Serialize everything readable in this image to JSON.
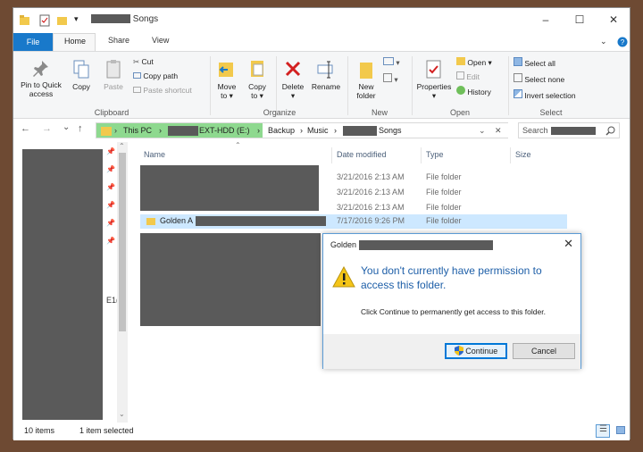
{
  "window": {
    "title_suffix": "Songs",
    "controls": {
      "minimize": "–",
      "maximize": "☐",
      "close": "✕"
    }
  },
  "ribbon_tabs": {
    "file": "File",
    "home": "Home",
    "share": "Share",
    "view": "View"
  },
  "ribbon": {
    "clipboard": {
      "pin_line1": "Pin to Quick",
      "pin_line2": "access",
      "copy": "Copy",
      "paste": "Paste",
      "cut": "Cut",
      "copy_path": "Copy path",
      "paste_shortcut": "Paste shortcut",
      "group_label": "Clipboard"
    },
    "organize": {
      "move_to_1": "Move",
      "move_to_2": "to ▾",
      "copy_to_1": "Copy",
      "copy_to_2": "to ▾",
      "delete_1": "Delete",
      "delete_2": "▾",
      "rename": "Rename",
      "group_label": "Organize"
    },
    "new": {
      "new_folder_1": "New",
      "new_folder_2": "folder",
      "group_label": "New"
    },
    "open": {
      "properties_1": "Properties",
      "properties_2": "▾",
      "open": "Open ▾",
      "edit": "Edit",
      "history": "History",
      "group_label": "Open"
    },
    "select": {
      "select_all": "Select all",
      "select_none": "Select none",
      "invert": "Invert selection",
      "group_label": "Select"
    }
  },
  "nav": {
    "back": "←",
    "forward": "→",
    "recent": "⌄",
    "up": "↑",
    "crumbs": {
      "this_pc": "This PC",
      "drive_suffix": "EXT-HDD (E:)",
      "backup": "Backup",
      "music": "Music",
      "songs_suffix": "Songs"
    },
    "search_placeholder": "Search"
  },
  "columns": {
    "name": "Name",
    "date": "Date modified",
    "type": "Type",
    "size": "Size"
  },
  "rows": [
    {
      "name": "",
      "date": "3/21/2016 2:13 AM",
      "type": "File folder"
    },
    {
      "name": "",
      "date": "3/21/2016 2:13 AM",
      "type": "File folder"
    },
    {
      "name": "",
      "date": "3/21/2016 2:13 AM",
      "type": "File folder"
    },
    {
      "name": "Golden A",
      "date": "7/17/2016 9:26 PM",
      "type": "File folder"
    }
  ],
  "navpane": {
    "fragment": "E1("
  },
  "status": {
    "items": "10 items",
    "selected": "1 item selected"
  },
  "dialog": {
    "title_prefix": "Golden",
    "message": "You don't currently have permission to access this folder.",
    "detail": "Click Continue to permanently get access to this folder.",
    "continue_label": "Continue",
    "cancel_label": "Cancel"
  },
  "colors": {
    "accent": "#1979ca",
    "breadcrumb_bg": "#8ed98f",
    "dialog_text": "#1e5fa8"
  }
}
